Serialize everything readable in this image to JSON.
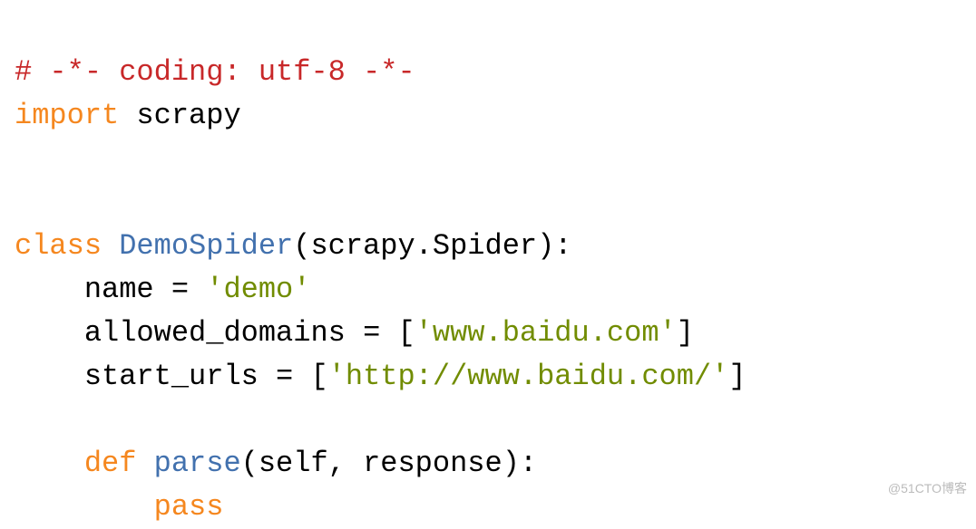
{
  "code": {
    "line1_comment": "# -*- coding: utf-8 -*-",
    "line2_import": "import",
    "line2_module": " scrapy",
    "blank1": "",
    "blank2": "",
    "line5_class": "class",
    "line5_space": " ",
    "line5_name": "DemoSpider",
    "line5_paren_open": "(",
    "line5_base": "scrapy.Spider",
    "line5_paren_close": "):",
    "line6_indent": "    ",
    "line6_var": "name = ",
    "line6_val": "'demo'",
    "line7_indent": "    ",
    "line7_var": "allowed_domains = [",
    "line7_val": "'www.baidu.com'",
    "line7_close": "]",
    "line8_indent": "    ",
    "line8_var": "start_urls = [",
    "line8_val": "'http://www.baidu.com/'",
    "line8_close": "]",
    "blank3": "",
    "line10_indent": "    ",
    "line10_def": "def",
    "line10_space": " ",
    "line10_name": "parse",
    "line10_args": "(self, response):",
    "line11_indent": "        ",
    "line11_pass": "pass"
  },
  "watermark": "@51CTO博客"
}
